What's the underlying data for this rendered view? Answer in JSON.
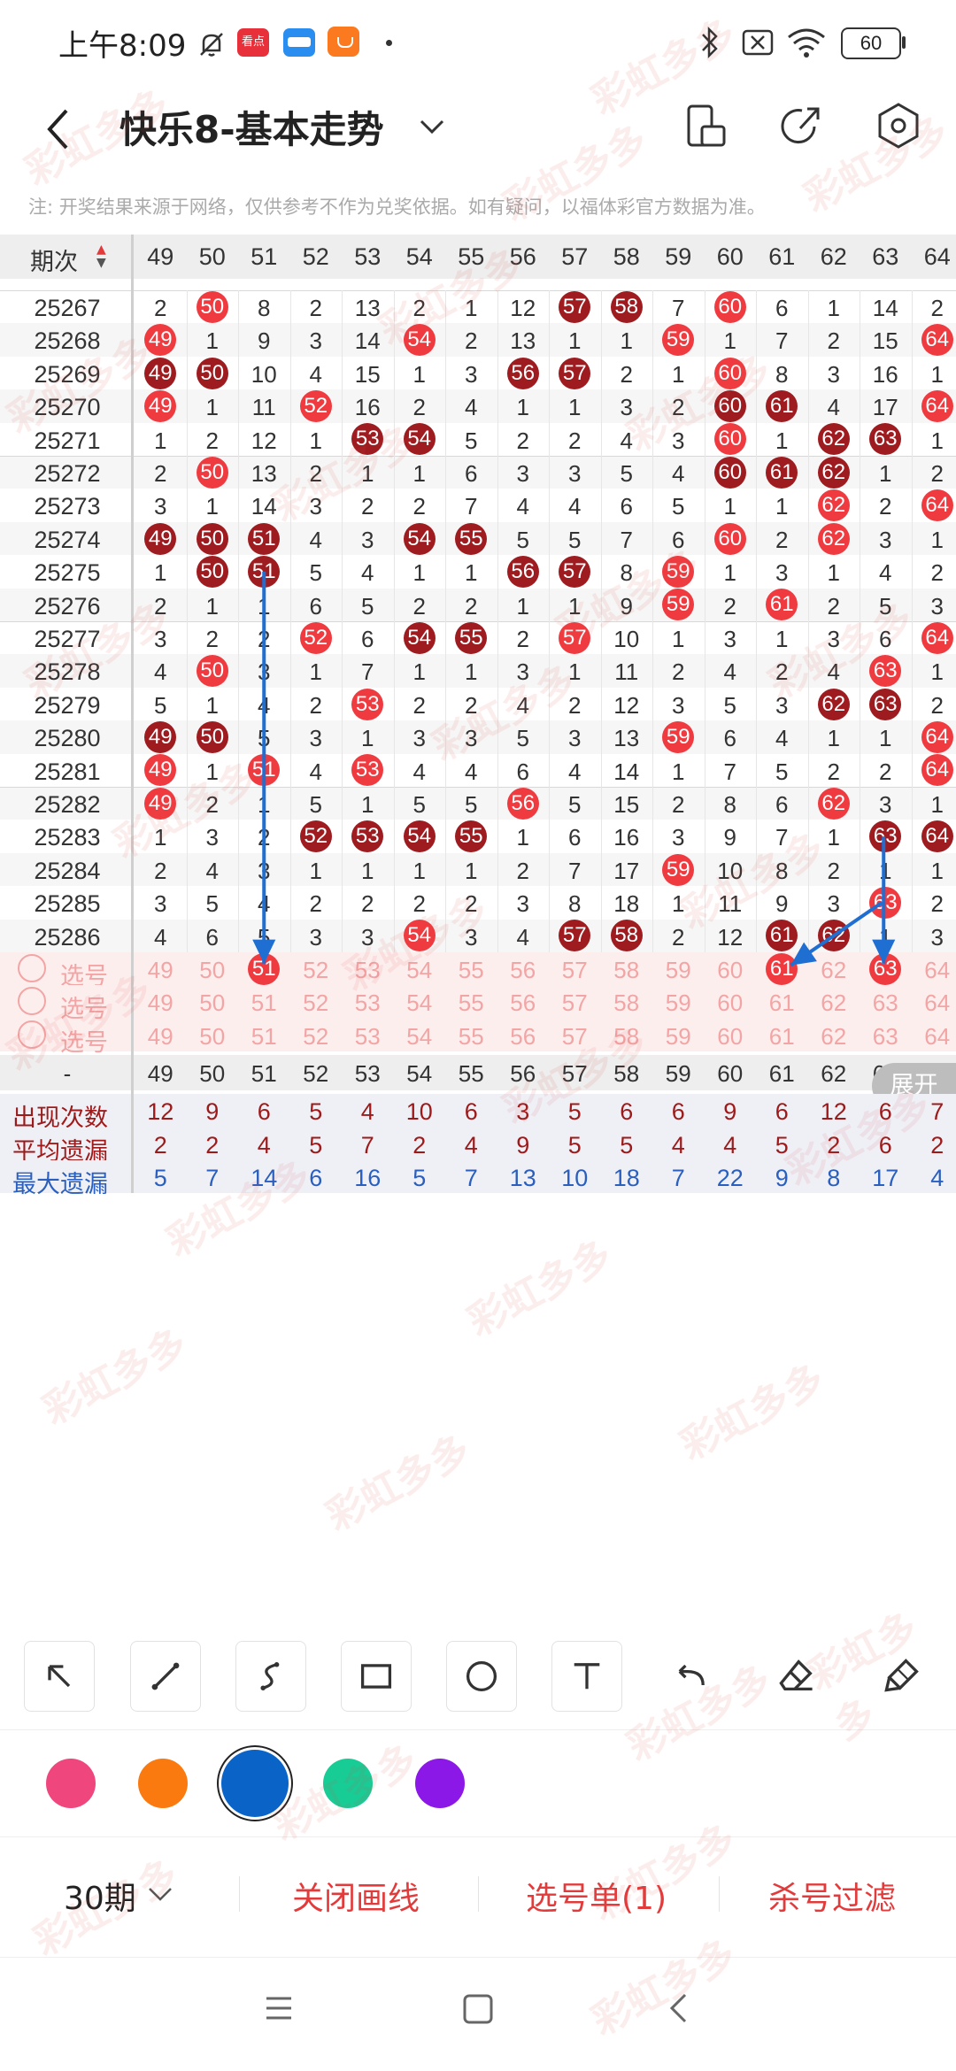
{
  "status_bar": {
    "time": "上午8:09",
    "battery": "60",
    "icons": [
      "mute-bell-icon",
      "news-app-icon",
      "wallet-app-icon",
      "shopping-app-icon",
      "dot-icon",
      "bluetooth-icon",
      "sim-off-icon",
      "wifi-icon",
      "battery-icon"
    ]
  },
  "header": {
    "title": "快乐8-基本走势",
    "icons": [
      "back-icon",
      "dropdown-chevron-icon",
      "phone-layout-icon",
      "share-icon",
      "settings-hexagon-icon"
    ]
  },
  "notice": "注: 开奖结果来源于网络，仅供参考不作为兑奖依据。如有疑问，以福体彩官方数据为准。",
  "table": {
    "issue_header": "期次",
    "columns": [
      "49",
      "50",
      "51",
      "52",
      "53",
      "54",
      "55",
      "56",
      "57",
      "58",
      "59",
      "60",
      "61",
      "62",
      "63",
      "64"
    ],
    "rows": [
      {
        "issue": "25267",
        "cells": [
          "2",
          "50",
          "8",
          "2",
          "13",
          "2",
          "1",
          "12",
          "57",
          "58",
          "7",
          "60",
          "6",
          "1",
          "14",
          "2"
        ]
      },
      {
        "issue": "25268",
        "cells": [
          "49",
          "1",
          "9",
          "3",
          "14",
          "54",
          "2",
          "13",
          "1",
          "1",
          "59",
          "1",
          "7",
          "2",
          "15",
          "64"
        ]
      },
      {
        "issue": "25269",
        "cells": [
          "49",
          "50",
          "10",
          "4",
          "15",
          "1",
          "3",
          "56",
          "57",
          "2",
          "1",
          "60",
          "8",
          "3",
          "16",
          "1"
        ]
      },
      {
        "issue": "25270",
        "cells": [
          "49",
          "1",
          "11",
          "52",
          "16",
          "2",
          "4",
          "1",
          "1",
          "3",
          "2",
          "60",
          "61",
          "4",
          "17",
          "64"
        ]
      },
      {
        "issue": "25271",
        "cells": [
          "1",
          "2",
          "12",
          "1",
          "53",
          "54",
          "5",
          "2",
          "2",
          "4",
          "3",
          "60",
          "1",
          "62",
          "63",
          "1"
        ]
      },
      {
        "issue": "25272",
        "cells": [
          "2",
          "50",
          "13",
          "2",
          "1",
          "1",
          "6",
          "3",
          "3",
          "5",
          "4",
          "60",
          "61",
          "62",
          "1",
          "2"
        ]
      },
      {
        "issue": "25273",
        "cells": [
          "3",
          "1",
          "14",
          "3",
          "2",
          "2",
          "7",
          "4",
          "4",
          "6",
          "5",
          "1",
          "1",
          "62",
          "2",
          "64"
        ]
      },
      {
        "issue": "25274",
        "cells": [
          "49",
          "50",
          "51",
          "4",
          "3",
          "54",
          "55",
          "5",
          "5",
          "7",
          "6",
          "60",
          "2",
          "62",
          "3",
          "1"
        ]
      },
      {
        "issue": "25275",
        "cells": [
          "1",
          "50",
          "51",
          "5",
          "4",
          "1",
          "1",
          "56",
          "57",
          "8",
          "59",
          "1",
          "3",
          "1",
          "4",
          "2"
        ]
      },
      {
        "issue": "25276",
        "cells": [
          "2",
          "1",
          "1",
          "6",
          "5",
          "2",
          "2",
          "1",
          "1",
          "9",
          "59",
          "2",
          "61",
          "2",
          "5",
          "3"
        ]
      },
      {
        "issue": "25277",
        "cells": [
          "3",
          "2",
          "2",
          "52",
          "6",
          "54",
          "55",
          "2",
          "57",
          "10",
          "1",
          "3",
          "1",
          "3",
          "6",
          "64"
        ]
      },
      {
        "issue": "25278",
        "cells": [
          "4",
          "50",
          "3",
          "1",
          "7",
          "1",
          "1",
          "3",
          "1",
          "11",
          "2",
          "4",
          "2",
          "4",
          "63",
          "1"
        ]
      },
      {
        "issue": "25279",
        "cells": [
          "5",
          "1",
          "4",
          "2",
          "53",
          "2",
          "2",
          "4",
          "2",
          "12",
          "3",
          "5",
          "3",
          "62",
          "63",
          "2"
        ]
      },
      {
        "issue": "25280",
        "cells": [
          "49",
          "50",
          "5",
          "3",
          "1",
          "3",
          "3",
          "5",
          "3",
          "13",
          "59",
          "6",
          "4",
          "1",
          "1",
          "64"
        ]
      },
      {
        "issue": "25281",
        "cells": [
          "49",
          "1",
          "51",
          "4",
          "53",
          "4",
          "4",
          "6",
          "4",
          "14",
          "1",
          "7",
          "5",
          "2",
          "2",
          "64"
        ]
      },
      {
        "issue": "25282",
        "cells": [
          "49",
          "2",
          "1",
          "5",
          "1",
          "5",
          "5",
          "56",
          "5",
          "15",
          "2",
          "8",
          "6",
          "62",
          "3",
          "1"
        ]
      },
      {
        "issue": "25283",
        "cells": [
          "1",
          "3",
          "2",
          "52",
          "53",
          "54",
          "55",
          "1",
          "6",
          "16",
          "3",
          "9",
          "7",
          "1",
          "63",
          "64"
        ]
      },
      {
        "issue": "25284",
        "cells": [
          "2",
          "4",
          "3",
          "1",
          "1",
          "1",
          "1",
          "2",
          "7",
          "17",
          "59",
          "10",
          "8",
          "2",
          "1",
          "1"
        ]
      },
      {
        "issue": "25285",
        "cells": [
          "3",
          "5",
          "4",
          "2",
          "2",
          "2",
          "2",
          "3",
          "8",
          "18",
          "1",
          "11",
          "9",
          "3",
          "63",
          "2"
        ]
      },
      {
        "issue": "25286",
        "cells": [
          "4",
          "6",
          "5",
          "3",
          "3",
          "54",
          "3",
          "4",
          "57",
          "58",
          "2",
          "12",
          "61",
          "62",
          "1",
          "3"
        ]
      }
    ],
    "select_label": "选号",
    "selected_in_row1": [
      "51",
      "61",
      "63"
    ],
    "stats_header_label": "-",
    "expand_label": "展开",
    "stats": [
      {
        "label": "出现次数",
        "values": [
          "12",
          "9",
          "6",
          "5",
          "4",
          "10",
          "6",
          "3",
          "5",
          "6",
          "6",
          "9",
          "6",
          "12",
          "6",
          "7"
        ]
      },
      {
        "label": "平均遗漏",
        "values": [
          "2",
          "2",
          "4",
          "5",
          "7",
          "2",
          "4",
          "9",
          "5",
          "5",
          "4",
          "4",
          "5",
          "2",
          "6",
          "2"
        ]
      },
      {
        "label": "最大遗漏",
        "values": [
          "5",
          "7",
          "14",
          "6",
          "16",
          "5",
          "7",
          "13",
          "10",
          "18",
          "7",
          "22",
          "9",
          "8",
          "17",
          "4"
        ]
      }
    ]
  },
  "toolbar": {
    "tools": [
      "arrow-tool-icon",
      "line-tool-icon",
      "curve-tool-icon",
      "rectangle-tool-icon",
      "circle-tool-icon",
      "text-tool-icon",
      "undo-icon",
      "eraser-icon",
      "clear-brush-icon"
    ]
  },
  "palette": {
    "colors": [
      "#f0467e",
      "#fb7a0f",
      "#0a64c8",
      "#18cc96",
      "#8c18e8"
    ],
    "selected_index": 2
  },
  "bottom_bar": {
    "period": "30期",
    "close_drawing": "关闭画线",
    "selection_list": "选号单(1)",
    "filter": "杀号过滤"
  },
  "nav_bar": {
    "icons": [
      "menu-icon",
      "home-icon",
      "back-nav-icon"
    ]
  },
  "watermark": "彩虹多多",
  "colors": {
    "ball_red": "#ef3b40",
    "ball_dark": "#9e1b1f",
    "accent_red": "#e23b3b",
    "arrow_blue": "#1f6fd3",
    "stats_red": "#9e1a1a",
    "stats_blue": "#2a5fbf",
    "select_pink": "#f3a5a5"
  }
}
